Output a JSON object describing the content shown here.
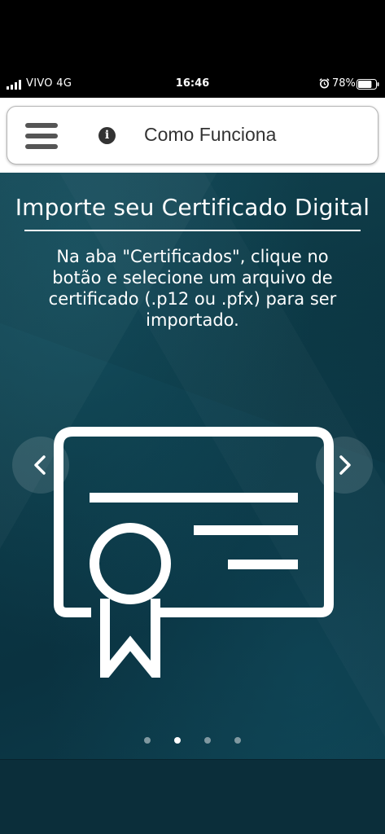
{
  "status_bar": {
    "carrier": "VIVO  4G",
    "time": "16:46",
    "battery": "78%",
    "battery_level": 0.78
  },
  "header": {
    "title": "Como Funciona",
    "menu_icon": "hamburger-menu-icon",
    "info_icon": "info-icon",
    "info_glyph": "i"
  },
  "slide": {
    "title": "Importe seu Certificado Digital",
    "description": "Na aba \"Certificados\", clique no botão   e selecione um arquivo de certificado (.p12 ou .pfx) para ser importado.",
    "illustration": "certificate-icon"
  },
  "carousel": {
    "total_slides": 4,
    "active_index": 1,
    "prev_icon": "chevron-left-icon",
    "next_icon": "chevron-right-icon"
  },
  "colors": {
    "slide_bg": "#0c3845",
    "footer_bg": "#0b2e3a",
    "header_bg": "#ffffff",
    "icon_gray": "#555555",
    "dot_inactive": "#7f98a0",
    "dot_active": "#ffffff"
  }
}
